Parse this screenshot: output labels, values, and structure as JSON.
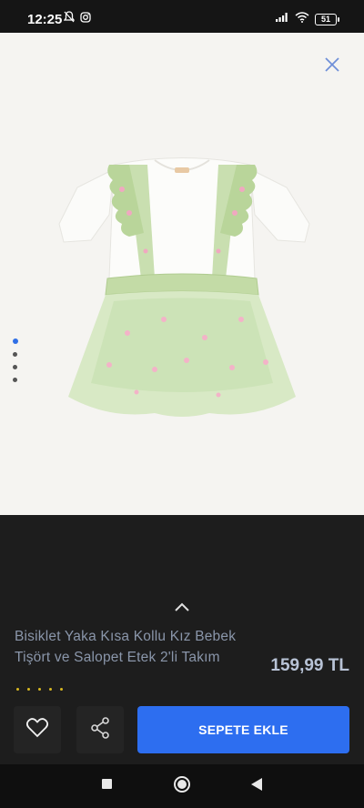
{
  "status_bar": {
    "time": "12:25",
    "battery": "51",
    "icons": [
      "notifications-off-icon",
      "instagram-icon",
      "signal-icon",
      "wifi-icon",
      "battery-icon"
    ]
  },
  "image_viewer": {
    "close_icon": "close-icon",
    "product_image": "green-tulle-skirt-set-image",
    "pages": 4,
    "active_page": 1
  },
  "product": {
    "title": "Bisiklet Yaka Kısa Kollu Kız Bebek Tişört ve Salopet Etek 2'li Takım",
    "price": "159,99 TL",
    "rating_count": 5
  },
  "actions": {
    "wishlist_icon": "heart-icon",
    "share_icon": "share-icon",
    "add_to_cart_label": "SEPETE EKLE"
  },
  "colors": {
    "accent": "#2d6ef0",
    "price": "#b8c3d6",
    "title": "#8a96aa",
    "rating": "#d8b820"
  }
}
